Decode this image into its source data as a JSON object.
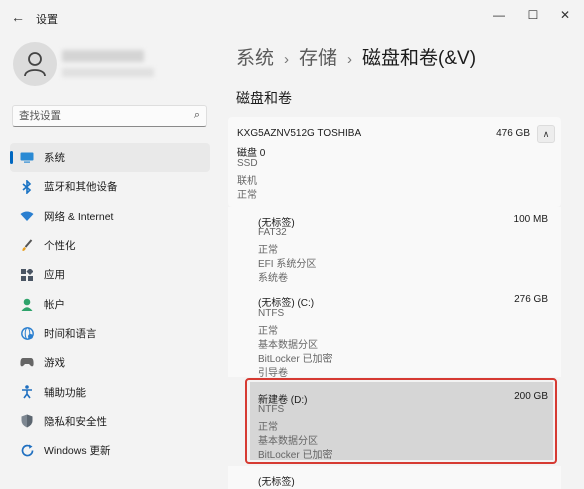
{
  "window": {
    "title": "设置",
    "back_icon": "←",
    "minimize_icon": "—",
    "maximize_icon": "☐",
    "close_icon": "✕"
  },
  "search": {
    "placeholder": "查找设置",
    "icon": "⌕"
  },
  "nav": {
    "items": [
      {
        "label": "系统",
        "icon": "system-icon",
        "active": true
      },
      {
        "label": "蓝牙和其他设备",
        "icon": "bluetooth-icon"
      },
      {
        "label": "网络 & Internet",
        "icon": "wifi-icon"
      },
      {
        "label": "个性化",
        "icon": "brush-icon"
      },
      {
        "label": "应用",
        "icon": "apps-icon"
      },
      {
        "label": "帐户",
        "icon": "account-icon"
      },
      {
        "label": "时间和语言",
        "icon": "globe-icon"
      },
      {
        "label": "游戏",
        "icon": "gamepad-icon"
      },
      {
        "label": "辅助功能",
        "icon": "accessibility-icon"
      },
      {
        "label": "隐私和安全性",
        "icon": "shield-icon"
      },
      {
        "label": "Windows 更新",
        "icon": "update-icon"
      }
    ]
  },
  "breadcrumb": {
    "part1": "系统",
    "sep": "›",
    "part2": "存储",
    "current": "磁盘和卷(&V)"
  },
  "section_title": "磁盘和卷",
  "disk": {
    "name": "KXG5AZNV512G TOSHIBA",
    "size": "476 GB",
    "label": "磁盘 0",
    "lines": [
      "SSD",
      "联机",
      "正常"
    ],
    "chevron": "∧"
  },
  "volumes": [
    {
      "name": "(无标签)",
      "size": "100 MB",
      "lines": [
        "FAT32",
        "正常",
        "EFI 系统分区",
        "系统卷"
      ]
    },
    {
      "name": "(无标签) (C:)",
      "size": "276 GB",
      "lines": [
        "NTFS",
        "正常",
        "基本数据分区",
        "BitLocker 已加密",
        "引导卷"
      ]
    },
    {
      "name": "新建卷 (D:)",
      "size": "200 GB",
      "lines": [
        "NTFS",
        "正常",
        "基本数据分区",
        "BitLocker 已加密"
      ],
      "selected": true
    },
    {
      "name": "(无标签)",
      "size": "",
      "lines": []
    }
  ],
  "colors": {
    "accent": "#0067c0",
    "highlight_border": "#d63a32"
  }
}
